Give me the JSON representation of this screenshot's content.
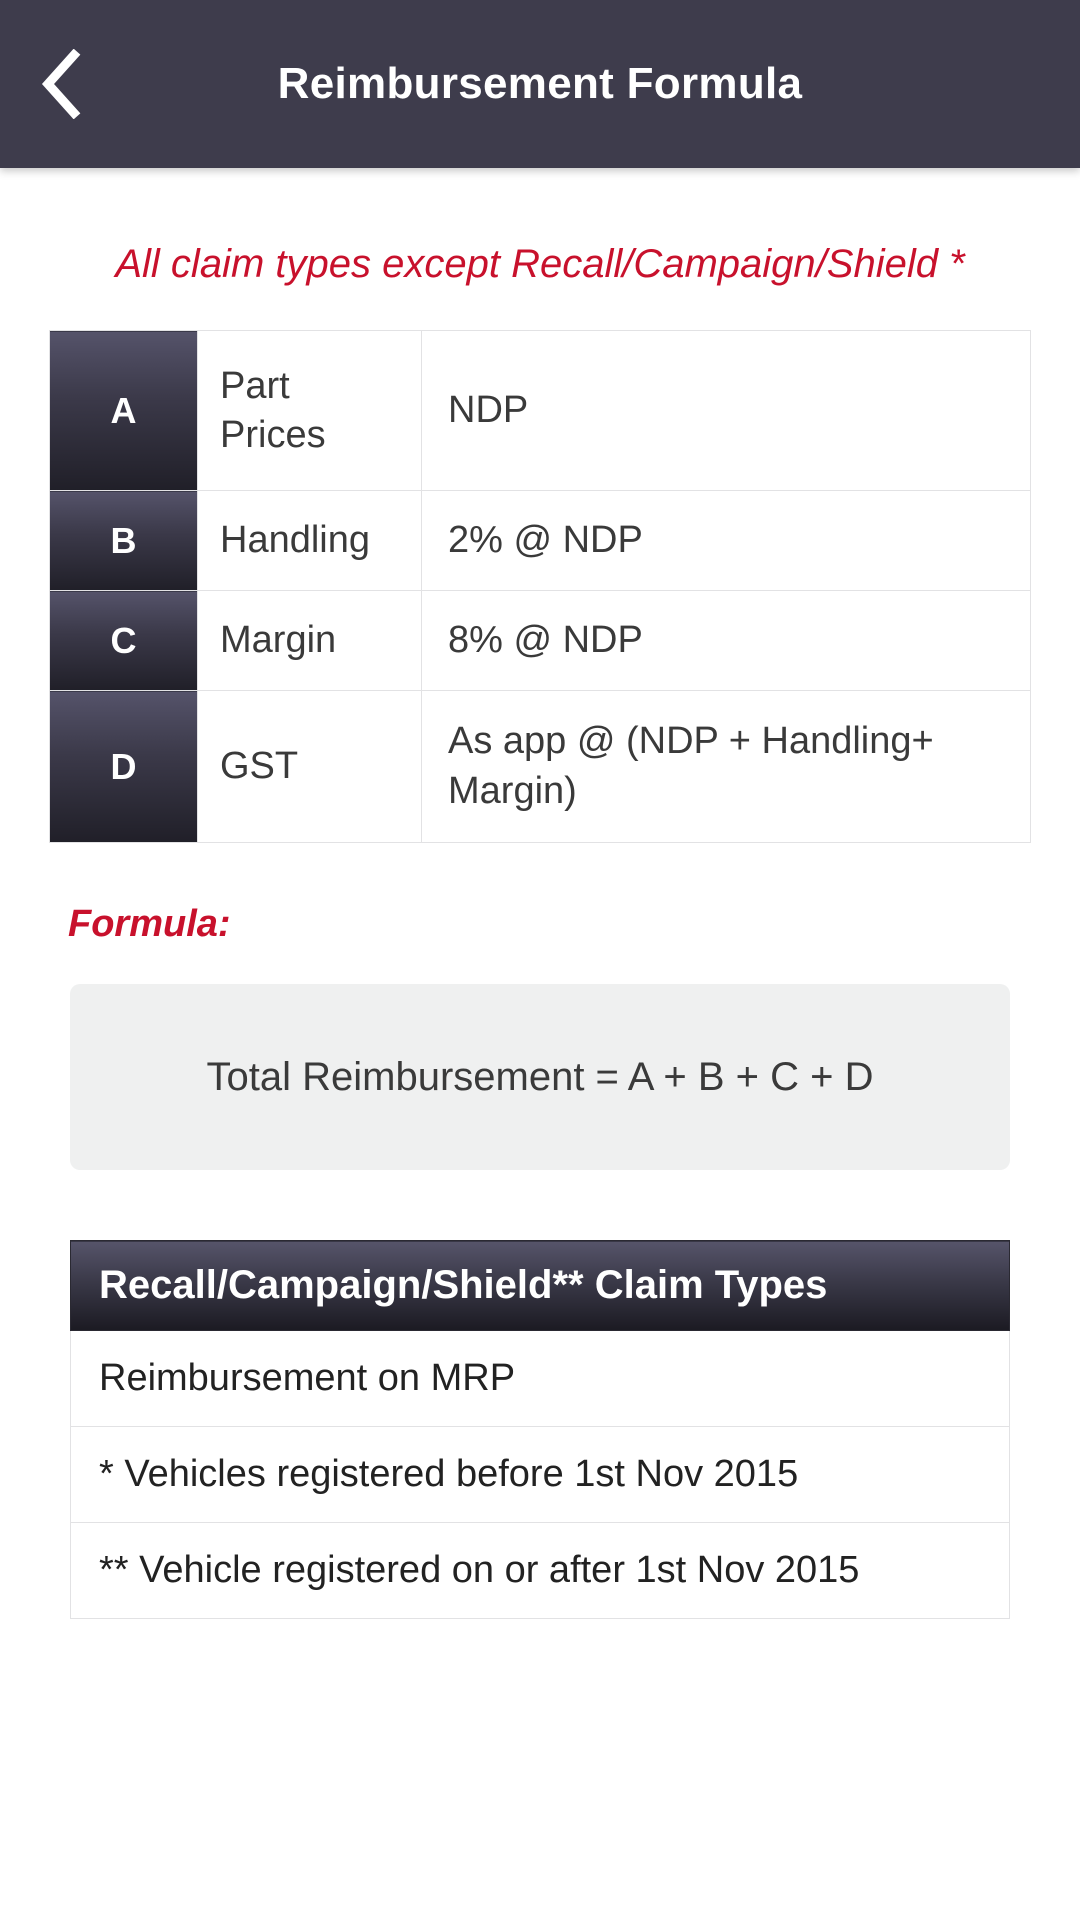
{
  "appbar": {
    "back_icon": "chevron-left-icon",
    "title": "Reimbursement Formula"
  },
  "content": {
    "subtitle": "All claim types except Recall/Campaign/Shield *",
    "formula_table": {
      "rows": [
        {
          "key": "A",
          "label": "Part Prices",
          "value": "NDP"
        },
        {
          "key": "B",
          "label": "Handling",
          "value": "2% @ NDP"
        },
        {
          "key": "C",
          "label": "Margin",
          "value": "8% @ NDP"
        },
        {
          "key": "D",
          "label": "GST",
          "value": "As app @ (NDP + Handling+ Margin)"
        }
      ]
    },
    "formula_heading": "Formula:",
    "formula_box_text": "Total Reimbursement = A + B + C + D",
    "claim_table": {
      "header": "Recall/Campaign/Shield** Claim Types",
      "rows": [
        "Reimbursement on MRP",
        "* Vehicles registered before 1st Nov 2015",
        "** Vehicle registered on or after 1st Nov 2015"
      ]
    }
  },
  "colors": {
    "appbar_bg": "#3e3c4c",
    "accent_red": "#c8112c",
    "key_cell_top": "#55536a",
    "key_cell_bottom": "#201f28",
    "formula_box_bg": "#eff0f0",
    "border": "#e2e2e4"
  }
}
